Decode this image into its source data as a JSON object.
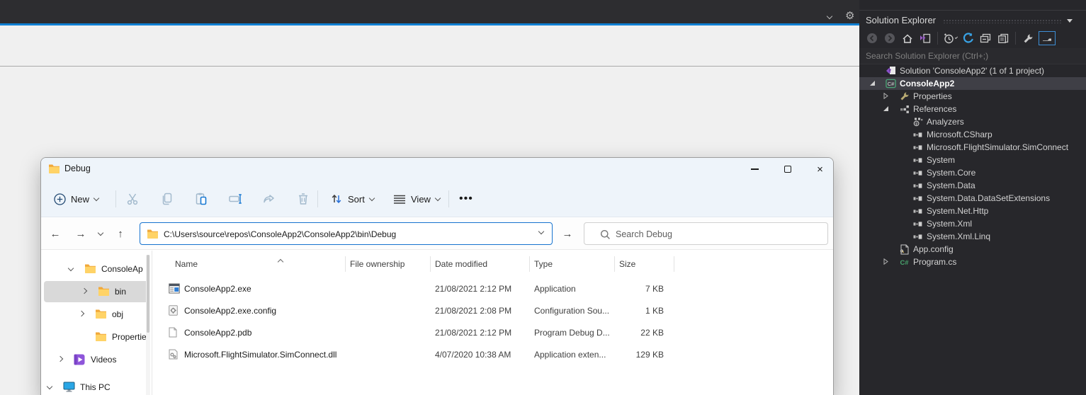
{
  "vs_shell": {
    "gear_icon": "gear-icon",
    "toolbar_caret_icon": "chevron-down-icon"
  },
  "solution_explorer": {
    "title": "Solution Explorer",
    "search_placeholder": "Search Solution Explorer (Ctrl+;)",
    "toolbar": [
      {
        "name": "back",
        "icon": "circle-back-icon"
      },
      {
        "name": "forward",
        "icon": "circle-forward-icon"
      },
      {
        "name": "home",
        "icon": "home-icon"
      },
      {
        "name": "sync-with-active-document",
        "icon": "sync-document-icon"
      },
      {
        "name": "separator"
      },
      {
        "name": "pending-changes-filter",
        "icon": "clock-icon",
        "caret": true
      },
      {
        "name": "refresh",
        "icon": "refresh-icon"
      },
      {
        "name": "collapse-all",
        "icon": "collapse-all-icon"
      },
      {
        "name": "show-all-files",
        "icon": "copy-documents-icon"
      },
      {
        "name": "separator"
      },
      {
        "name": "properties",
        "icon": "wrench-icon"
      },
      {
        "name": "preview-selected-items",
        "icon": "pin-preview-icon",
        "active": true
      }
    ],
    "tree": [
      {
        "label": "Solution 'ConsoleApp2' (1 of 1 project)",
        "icon": "solution",
        "indent": 0,
        "expander": null
      },
      {
        "label": "ConsoleApp2",
        "icon": "csharp-project",
        "indent": 0,
        "expander": "expanded",
        "bold": true,
        "selected": true
      },
      {
        "label": "Properties",
        "icon": "wrench",
        "indent": 1,
        "expander": "collapsed"
      },
      {
        "label": "References",
        "icon": "references",
        "indent": 1,
        "expander": "expanded"
      },
      {
        "label": "Analyzers",
        "icon": "analyzers",
        "indent": 2,
        "expander": null
      },
      {
        "label": "Microsoft.CSharp",
        "icon": "assembly",
        "indent": 2,
        "expander": null
      },
      {
        "label": "Microsoft.FlightSimulator.SimConnect",
        "icon": "assembly",
        "indent": 2,
        "expander": null
      },
      {
        "label": "System",
        "icon": "assembly",
        "indent": 2,
        "expander": null
      },
      {
        "label": "System.Core",
        "icon": "assembly",
        "indent": 2,
        "expander": null
      },
      {
        "label": "System.Data",
        "icon": "assembly",
        "indent": 2,
        "expander": null
      },
      {
        "label": "System.Data.DataSetExtensions",
        "icon": "assembly",
        "indent": 2,
        "expander": null
      },
      {
        "label": "System.Net.Http",
        "icon": "assembly",
        "indent": 2,
        "expander": null
      },
      {
        "label": "System.Xml",
        "icon": "assembly",
        "indent": 2,
        "expander": null
      },
      {
        "label": "System.Xml.Linq",
        "icon": "assembly",
        "indent": 2,
        "expander": null
      },
      {
        "label": "App.config",
        "icon": "app-config",
        "indent": 1,
        "expander": null
      },
      {
        "label": "Program.cs",
        "icon": "csharp-file",
        "indent": 1,
        "expander": "collapsed"
      }
    ]
  },
  "explorer_window": {
    "title": "Debug",
    "title_icon": "folder-icon",
    "window_controls": [
      {
        "name": "minimize"
      },
      {
        "name": "maximize"
      },
      {
        "name": "close",
        "glyph": "×"
      }
    ],
    "toolbar": {
      "new_label": "New",
      "actions": [
        {
          "name": "cut",
          "icon": "scissors-icon"
        },
        {
          "name": "copy",
          "icon": "copy-icon"
        },
        {
          "name": "paste",
          "icon": "paste-icon"
        },
        {
          "name": "rename",
          "icon": "rename-icon"
        },
        {
          "name": "share",
          "icon": "share-icon"
        },
        {
          "name": "delete",
          "icon": "trash-icon"
        }
      ],
      "sort_label": "Sort",
      "view_label": "View",
      "more_glyph": "•••"
    },
    "address_bar": {
      "back_glyph": "←",
      "forward_glyph": "→",
      "up_glyph": "↑",
      "go_glyph": "→",
      "path": "C:\\Users\\source\\repos\\ConsoleApp2\\ConsoleApp2\\bin\\Debug"
    },
    "search_placeholder": "Search Debug",
    "nav_pane": [
      {
        "label": "ConsoleAp",
        "icon": "folder",
        "chevron": "down",
        "indent": 2
      },
      {
        "label": "bin",
        "icon": "folder",
        "chevron": "right",
        "indent": 3,
        "selected": true
      },
      {
        "label": "obj",
        "icon": "folder",
        "chevron": "right",
        "indent": 3
      },
      {
        "label": "Propertie",
        "icon": "folder",
        "chevron": null,
        "indent": 3
      },
      {
        "label": "Videos",
        "icon": "videos",
        "chevron": "right",
        "indent": 1
      },
      {
        "label": "This PC",
        "icon": "this-pc",
        "chevron": "down",
        "indent": 0
      }
    ],
    "file_list": {
      "columns": [
        "Name",
        "File ownership",
        "Date modified",
        "Type",
        "Size"
      ],
      "sorted_column": "Name",
      "rows": [
        {
          "name": "ConsoleApp2.exe",
          "icon": "exe",
          "file_ownership": "",
          "date_modified": "21/08/2021 2:12 PM",
          "type": "Application",
          "size": "7 KB"
        },
        {
          "name": "ConsoleApp2.exe.config",
          "icon": "config",
          "file_ownership": "",
          "date_modified": "21/08/2021 2:08 PM",
          "type": "Configuration Sou...",
          "size": "1 KB"
        },
        {
          "name": "ConsoleApp2.pdb",
          "icon": "pdb",
          "file_ownership": "",
          "date_modified": "21/08/2021 2:12 PM",
          "type": "Program Debug D...",
          "size": "22 KB"
        },
        {
          "name": "Microsoft.FlightSimulator.SimConnect.dll",
          "icon": "dll",
          "file_ownership": "",
          "date_modified": "4/07/2020 10:38 AM",
          "type": "Application exten...",
          "size": "129 KB"
        }
      ]
    }
  }
}
